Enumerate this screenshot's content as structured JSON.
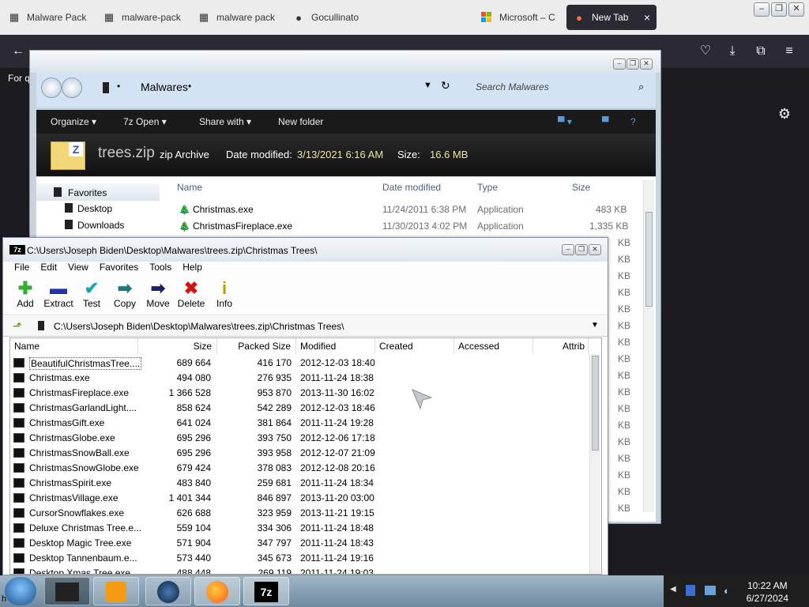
{
  "firefox": {
    "tabs": [
      {
        "label": "Malware Pack",
        "icon": "document-icon"
      },
      {
        "label": "malware-pack",
        "icon": "document-icon"
      },
      {
        "label": "malware pack",
        "icon": "document-icon"
      },
      {
        "label": "Gocullinato",
        "icon": "github-icon"
      },
      {
        "label": "Microsoft – C",
        "icon": "microsoft-icon"
      },
      {
        "label": "New Tab",
        "icon": "firefox-icon",
        "active": true
      }
    ],
    "close_tab_glyph": "×",
    "bookmark_text": "For q",
    "search_placeholder": ""
  },
  "explorer": {
    "address_folder": "Malwares",
    "search_placeholder": "Search Malwares",
    "commands": {
      "organize": "Organize",
      "open": "Open",
      "share_with": "Share with",
      "new_folder": "New folder"
    },
    "details": {
      "file_name": "trees.zip",
      "type": "zip Archive",
      "date_label": "Date modified:",
      "date_value": "3/13/2021 6:16 AM",
      "size_label": "Size:",
      "size_value": "16.6 MB"
    },
    "nav": {
      "favorites": "Favorites",
      "desktop": "Desktop",
      "downloads": "Downloads"
    },
    "columns": {
      "name": "Name",
      "date": "Date modified",
      "type": "Type",
      "size": "Size"
    },
    "rows": [
      {
        "name": "Christmas.exe",
        "date": "11/24/2011 6:38 PM",
        "type": "Application",
        "size": "483 KB"
      },
      {
        "name": "ChristmasFireplace.exe",
        "date": "11/30/2013 4:02 PM",
        "type": "Application",
        "size": "1,335 KB"
      }
    ],
    "partial_sizes": [
      "KB",
      "KB",
      "KB",
      "KB",
      "KB",
      "KB",
      "KB",
      "KB",
      "KB",
      "KB",
      "KB",
      "KB",
      "KB",
      "KB",
      "KB",
      "KB",
      "KB"
    ]
  },
  "sevenzip": {
    "title": "C:\\Users\\Joseph Biden\\Desktop\\Malwares\\trees.zip\\Christmas Trees\\",
    "menu": [
      "File",
      "Edit",
      "View",
      "Favorites",
      "Tools",
      "Help"
    ],
    "toolbar": [
      {
        "label": "Add",
        "icon": "add-icon"
      },
      {
        "label": "Extract",
        "icon": "extract-icon"
      },
      {
        "label": "Test",
        "icon": "test-icon"
      },
      {
        "label": "Copy",
        "icon": "copy-icon"
      },
      {
        "label": "Move",
        "icon": "move-icon"
      },
      {
        "label": "Delete",
        "icon": "delete-icon"
      },
      {
        "label": "Info",
        "icon": "info-icon"
      }
    ],
    "path": "C:\\Users\\Joseph Biden\\Desktop\\Malwares\\trees.zip\\Christmas Trees\\",
    "columns": {
      "name": "Name",
      "size": "Size",
      "packed": "Packed Size",
      "modified": "Modified",
      "created": "Created",
      "accessed": "Accessed",
      "attrib": "Attrib"
    },
    "files": [
      {
        "name": "BeautifulChristmasTree....",
        "size": "689 664",
        "packed": "416 170",
        "modified": "2012-12-03 18:40"
      },
      {
        "name": "Christmas.exe",
        "size": "494 080",
        "packed": "276 935",
        "modified": "2011-11-24 18:38"
      },
      {
        "name": "ChristmasFireplace.exe",
        "size": "1 366 528",
        "packed": "953 870",
        "modified": "2013-11-30 16:02"
      },
      {
        "name": "ChristmasGarlandLight....",
        "size": "858 624",
        "packed": "542 289",
        "modified": "2012-12-03 18:46"
      },
      {
        "name": "ChristmasGift.exe",
        "size": "641 024",
        "packed": "381 864",
        "modified": "2011-11-24 19:28"
      },
      {
        "name": "ChristmasGlobe.exe",
        "size": "695 296",
        "packed": "393 750",
        "modified": "2012-12-06 17:18"
      },
      {
        "name": "ChristmasSnowBall.exe",
        "size": "695 296",
        "packed": "393 958",
        "modified": "2012-12-07 21:09"
      },
      {
        "name": "ChristmasSnowGlobe.exe",
        "size": "679 424",
        "packed": "378 083",
        "modified": "2012-12-08 20:16"
      },
      {
        "name": "ChristmasSpirit.exe",
        "size": "483 840",
        "packed": "259 681",
        "modified": "2011-11-24 18:34"
      },
      {
        "name": "ChristmasVillage.exe",
        "size": "1 401 344",
        "packed": "846 897",
        "modified": "2013-11-20 03:00"
      },
      {
        "name": "CursorSnowflakes.exe",
        "size": "626 688",
        "packed": "323 959",
        "modified": "2013-11-21 19:15"
      },
      {
        "name": "Deluxe Christmas Tree.e...",
        "size": "559 104",
        "packed": "334 306",
        "modified": "2011-11-24 18:48"
      },
      {
        "name": "Desktop Magic Tree.exe",
        "size": "571 904",
        "packed": "347 797",
        "modified": "2011-11-24 18:43"
      },
      {
        "name": "Desktop Tannenbaum.e...",
        "size": "573 440",
        "packed": "345 673",
        "modified": "2011-11-24 19:16"
      },
      {
        "name": "Desktop Xmas Tree.exe",
        "size": "488 448",
        "packed": "269 119",
        "modified": "2011-11-24 19:03"
      }
    ]
  },
  "taskbar": {
    "time": "10:22 AM",
    "date": "6/27/2024",
    "corner_text": "h",
    "items": [
      "start-orb-icon",
      "explorer-icon",
      "media-player-icon",
      "globe-icon",
      "firefox-icon",
      "7zip-icon"
    ]
  },
  "colors": {
    "firefox_dark": "#2b2a33",
    "explorer_blue": "#d3e3f3",
    "taskbar": "#8aa2b6"
  }
}
